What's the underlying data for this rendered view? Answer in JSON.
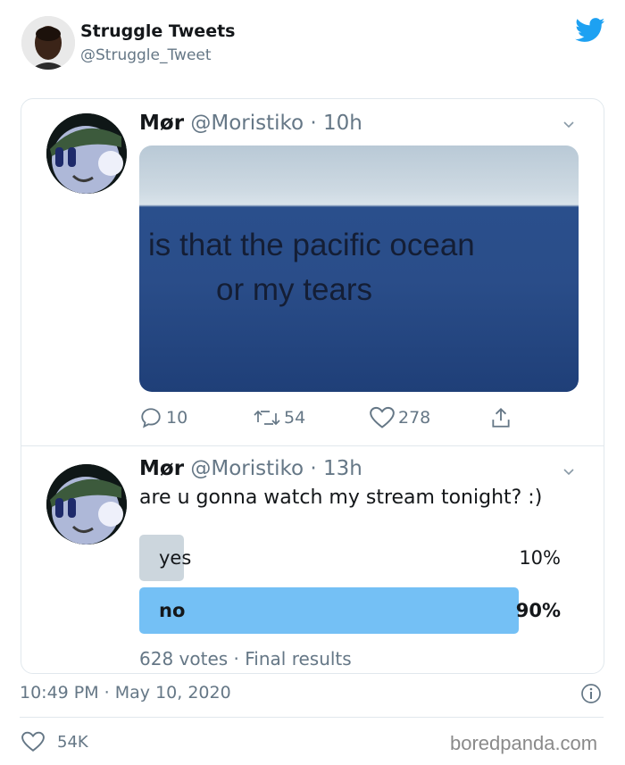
{
  "outer": {
    "name": "Struggle Tweets",
    "handle": "@Struggle_Tweet",
    "timestamp": "10:49 PM · May 10, 2020",
    "likes": "54K",
    "watermark": "boredpanda.com"
  },
  "tweets": [
    {
      "name": "Mør",
      "handle": "@Moristiko",
      "time": "· 10h",
      "image_text_line1": "is that the pacific ocean",
      "image_text_line2": "or my tears",
      "replies": "10",
      "retweets": "54",
      "likes": "278"
    },
    {
      "name": "Mør",
      "handle": "@Moristiko",
      "time": "· 13h",
      "question": "are u gonna watch my stream tonight? :)",
      "poll": [
        {
          "label": "yes",
          "percent_text": "10%",
          "fraction": 0.1,
          "winner": false
        },
        {
          "label": "no",
          "percent_text": "90%",
          "fraction": 0.9,
          "winner": true
        }
      ],
      "votes": "628 votes · Final results"
    }
  ],
  "colors": {
    "twitter_blue": "#1da1f2",
    "poll_winner": "#74c0f5",
    "poll_loser": "#ccd6dd",
    "secondary_text": "#657786",
    "border": "#e1e8ed"
  },
  "icons": [
    "twitter-bird-icon",
    "chevron-down-icon",
    "reply-icon",
    "retweet-icon",
    "heart-icon",
    "share-icon",
    "info-icon"
  ]
}
